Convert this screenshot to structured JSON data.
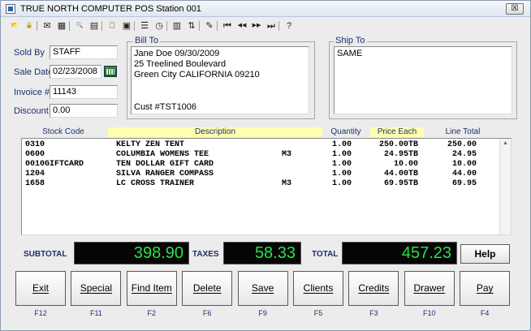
{
  "window": {
    "title": "TRUE NORTH COMPUTER POS Station 001",
    "close_glyph": "☒"
  },
  "toolbar": {
    "icons": [
      {
        "name": "open-icon",
        "glyph": "📂"
      },
      {
        "name": "lock-icon",
        "glyph": "🔒"
      },
      {
        "name": "mail-icon",
        "glyph": "✉"
      },
      {
        "name": "grid-view-icon",
        "glyph": "▦"
      },
      {
        "name": "search-icon",
        "glyph": "🔍"
      },
      {
        "name": "report-icon",
        "glyph": "▤"
      },
      {
        "name": "clipboard-icon",
        "glyph": "📋"
      },
      {
        "name": "calculator-icon",
        "glyph": "▣"
      },
      {
        "name": "list-icon",
        "glyph": "☰"
      },
      {
        "name": "clock-icon",
        "glyph": "◷"
      },
      {
        "name": "table-icon",
        "glyph": "▥"
      },
      {
        "name": "sort-icon",
        "glyph": "⇅"
      },
      {
        "name": "pencil-icon",
        "glyph": "✎"
      },
      {
        "name": "first-record-icon",
        "glyph": "⏮"
      },
      {
        "name": "prev-record-icon",
        "glyph": "◀◀"
      },
      {
        "name": "next-record-icon",
        "glyph": "▶▶"
      },
      {
        "name": "last-record-icon",
        "glyph": "⏭"
      },
      {
        "name": "help-icon",
        "glyph": "?"
      }
    ]
  },
  "form": {
    "sold_by": {
      "label": "Sold By",
      "value": "STAFF"
    },
    "sale_date": {
      "label": "Sale Date",
      "value": "02/23/2008"
    },
    "invoice": {
      "label": "Invoice #",
      "value": "11143"
    },
    "discount": {
      "label": "Discount",
      "value": "0.00"
    }
  },
  "bill_to": {
    "label": "Bill To",
    "lines": [
      "Jane Doe   09/30/2009",
      "25 Treelined Boulevard",
      "Green City CALIFORNIA 09210",
      "",
      "",
      "Cust #TST1006"
    ]
  },
  "ship_to": {
    "label": "Ship To",
    "lines": [
      "SAME"
    ]
  },
  "table": {
    "headers": {
      "stock_code": "Stock Code",
      "description": "Description",
      "quantity": "Quantity",
      "price_each": "Price Each",
      "line_total": "Line Total"
    },
    "rows": [
      {
        "stock_code": "0310",
        "description": "KELTY ZEN TENT",
        "size": "",
        "quantity": "1.00",
        "price_each": "250.00TB",
        "line_total": "250.00"
      },
      {
        "stock_code": "0600",
        "description": "COLUMBIA WOMENS TEE",
        "size": "M3",
        "quantity": "1.00",
        "price_each": "24.95TB",
        "line_total": "24.95"
      },
      {
        "stock_code": "0010GIFTCARD",
        "description": "TEN DOLLAR GIFT CARD",
        "size": "",
        "quantity": "1.00",
        "price_each": "10.00",
        "line_total": "10.00"
      },
      {
        "stock_code": "1204",
        "description": "SILVA RANGER COMPASS",
        "size": "",
        "quantity": "1.00",
        "price_each": "44.00TB",
        "line_total": "44.00"
      },
      {
        "stock_code": "1658",
        "description": "LC CROSS TRAINER",
        "size": "M3",
        "quantity": "1.00",
        "price_each": "69.95TB",
        "line_total": "69.95"
      }
    ]
  },
  "totals": {
    "subtotal_label": "SUBTOTAL",
    "subtotal": "398.90",
    "taxes_label": "TAXES",
    "taxes": "58.33",
    "total_label": "TOTAL",
    "total": "457.23",
    "help_label": "Help"
  },
  "buttons": [
    {
      "label": "Exit",
      "key": "F12"
    },
    {
      "label": "Special",
      "key": "F11"
    },
    {
      "label": "Find Item",
      "key": "F2"
    },
    {
      "label": "Delete",
      "key": "F6"
    },
    {
      "label": "Save",
      "key": "F9"
    },
    {
      "label": "Clients",
      "key": "F5"
    },
    {
      "label": "Credits",
      "key": "F3"
    },
    {
      "label": "Drawer",
      "key": "F10"
    },
    {
      "label": "Pay",
      "key": "F4"
    }
  ],
  "colors": {
    "header_highlight": "#ffffb0",
    "lcd_green": "#27e44a",
    "label_blue": "#1d2f6e"
  }
}
